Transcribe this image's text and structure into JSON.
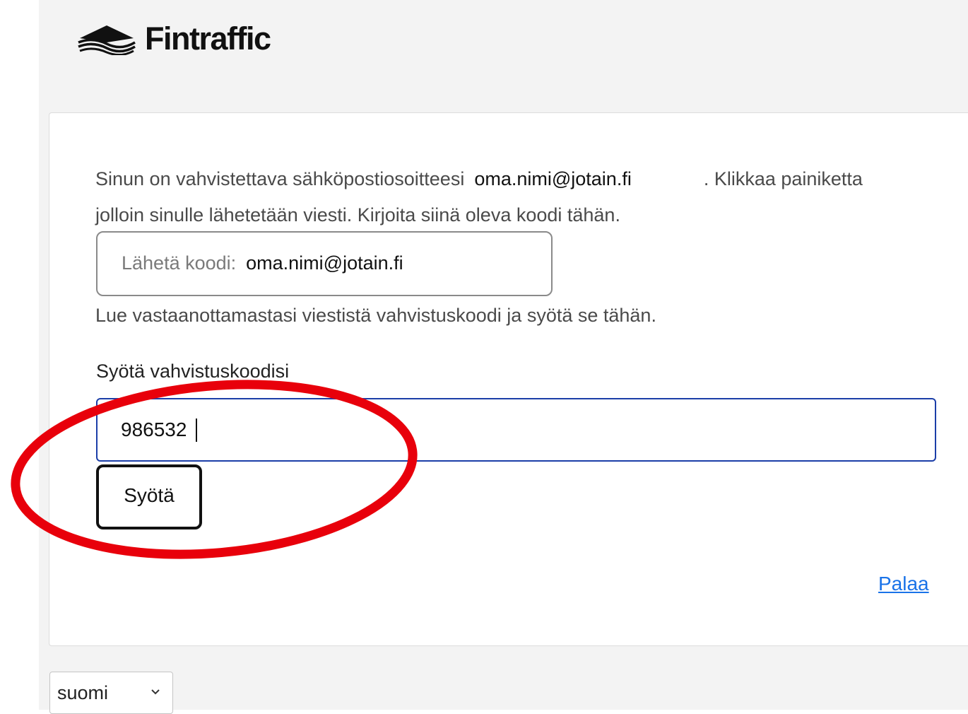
{
  "brand": {
    "name": "Fintraffic",
    "logo_icon": "fintraffic-waves-icon"
  },
  "verification": {
    "intro_before_email": "Sinun on vahvistettava sähköpostiosoitteesi",
    "intro_email": "oma.nimi@jotain.fi",
    "intro_after_email": ". Klikkaa painiketta jolloin sinulle lähetetään viesti. Kirjoita siinä oleva koodi tähän.",
    "send_code_label": "Lähetä koodi:",
    "send_code_email": "oma.nimi@jotain.fi",
    "read_message_note": "Lue vastaanottamastasi viestistä vahvistuskoodi ja syötä se tähän.",
    "code_field_label": "Syötä vahvistuskoodisi",
    "code_value": "986532",
    "submit_label": "Syötä",
    "back_link": "Palaa"
  },
  "footer": {
    "language_selected": "suomi",
    "language_chevron_icon": "chevron-down-icon"
  },
  "colors": {
    "page_background": "#f3f3f3",
    "input_focus_border": "#1b3ea8",
    "link": "#1a73e8",
    "annotation_ellipse": "#e8000b"
  }
}
